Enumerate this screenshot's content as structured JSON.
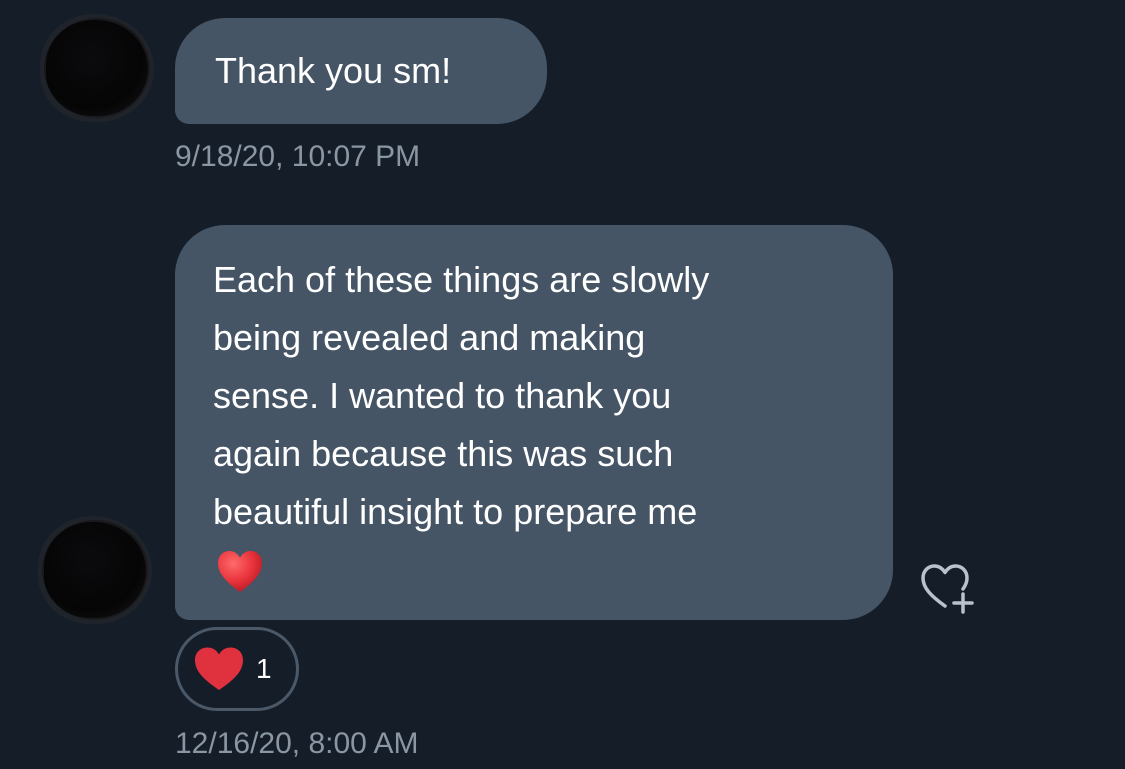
{
  "messages": [
    {
      "text": "Thank you sm!",
      "timestamp": "9/18/20, 10:07 PM"
    },
    {
      "lines": [
        "Each of these things are slowly",
        "being revealed and making",
        "sense. I wanted to thank you",
        "again because this was such",
        "beautiful insight to prepare me"
      ],
      "emoji": "red-heart-icon",
      "reaction_count": "1",
      "timestamp": "12/16/20, 8:00 AM"
    }
  ],
  "colors": {
    "background": "#151d28",
    "bubble": "#455566",
    "timestamp": "#8a96a3",
    "heart": "#e0313f"
  }
}
